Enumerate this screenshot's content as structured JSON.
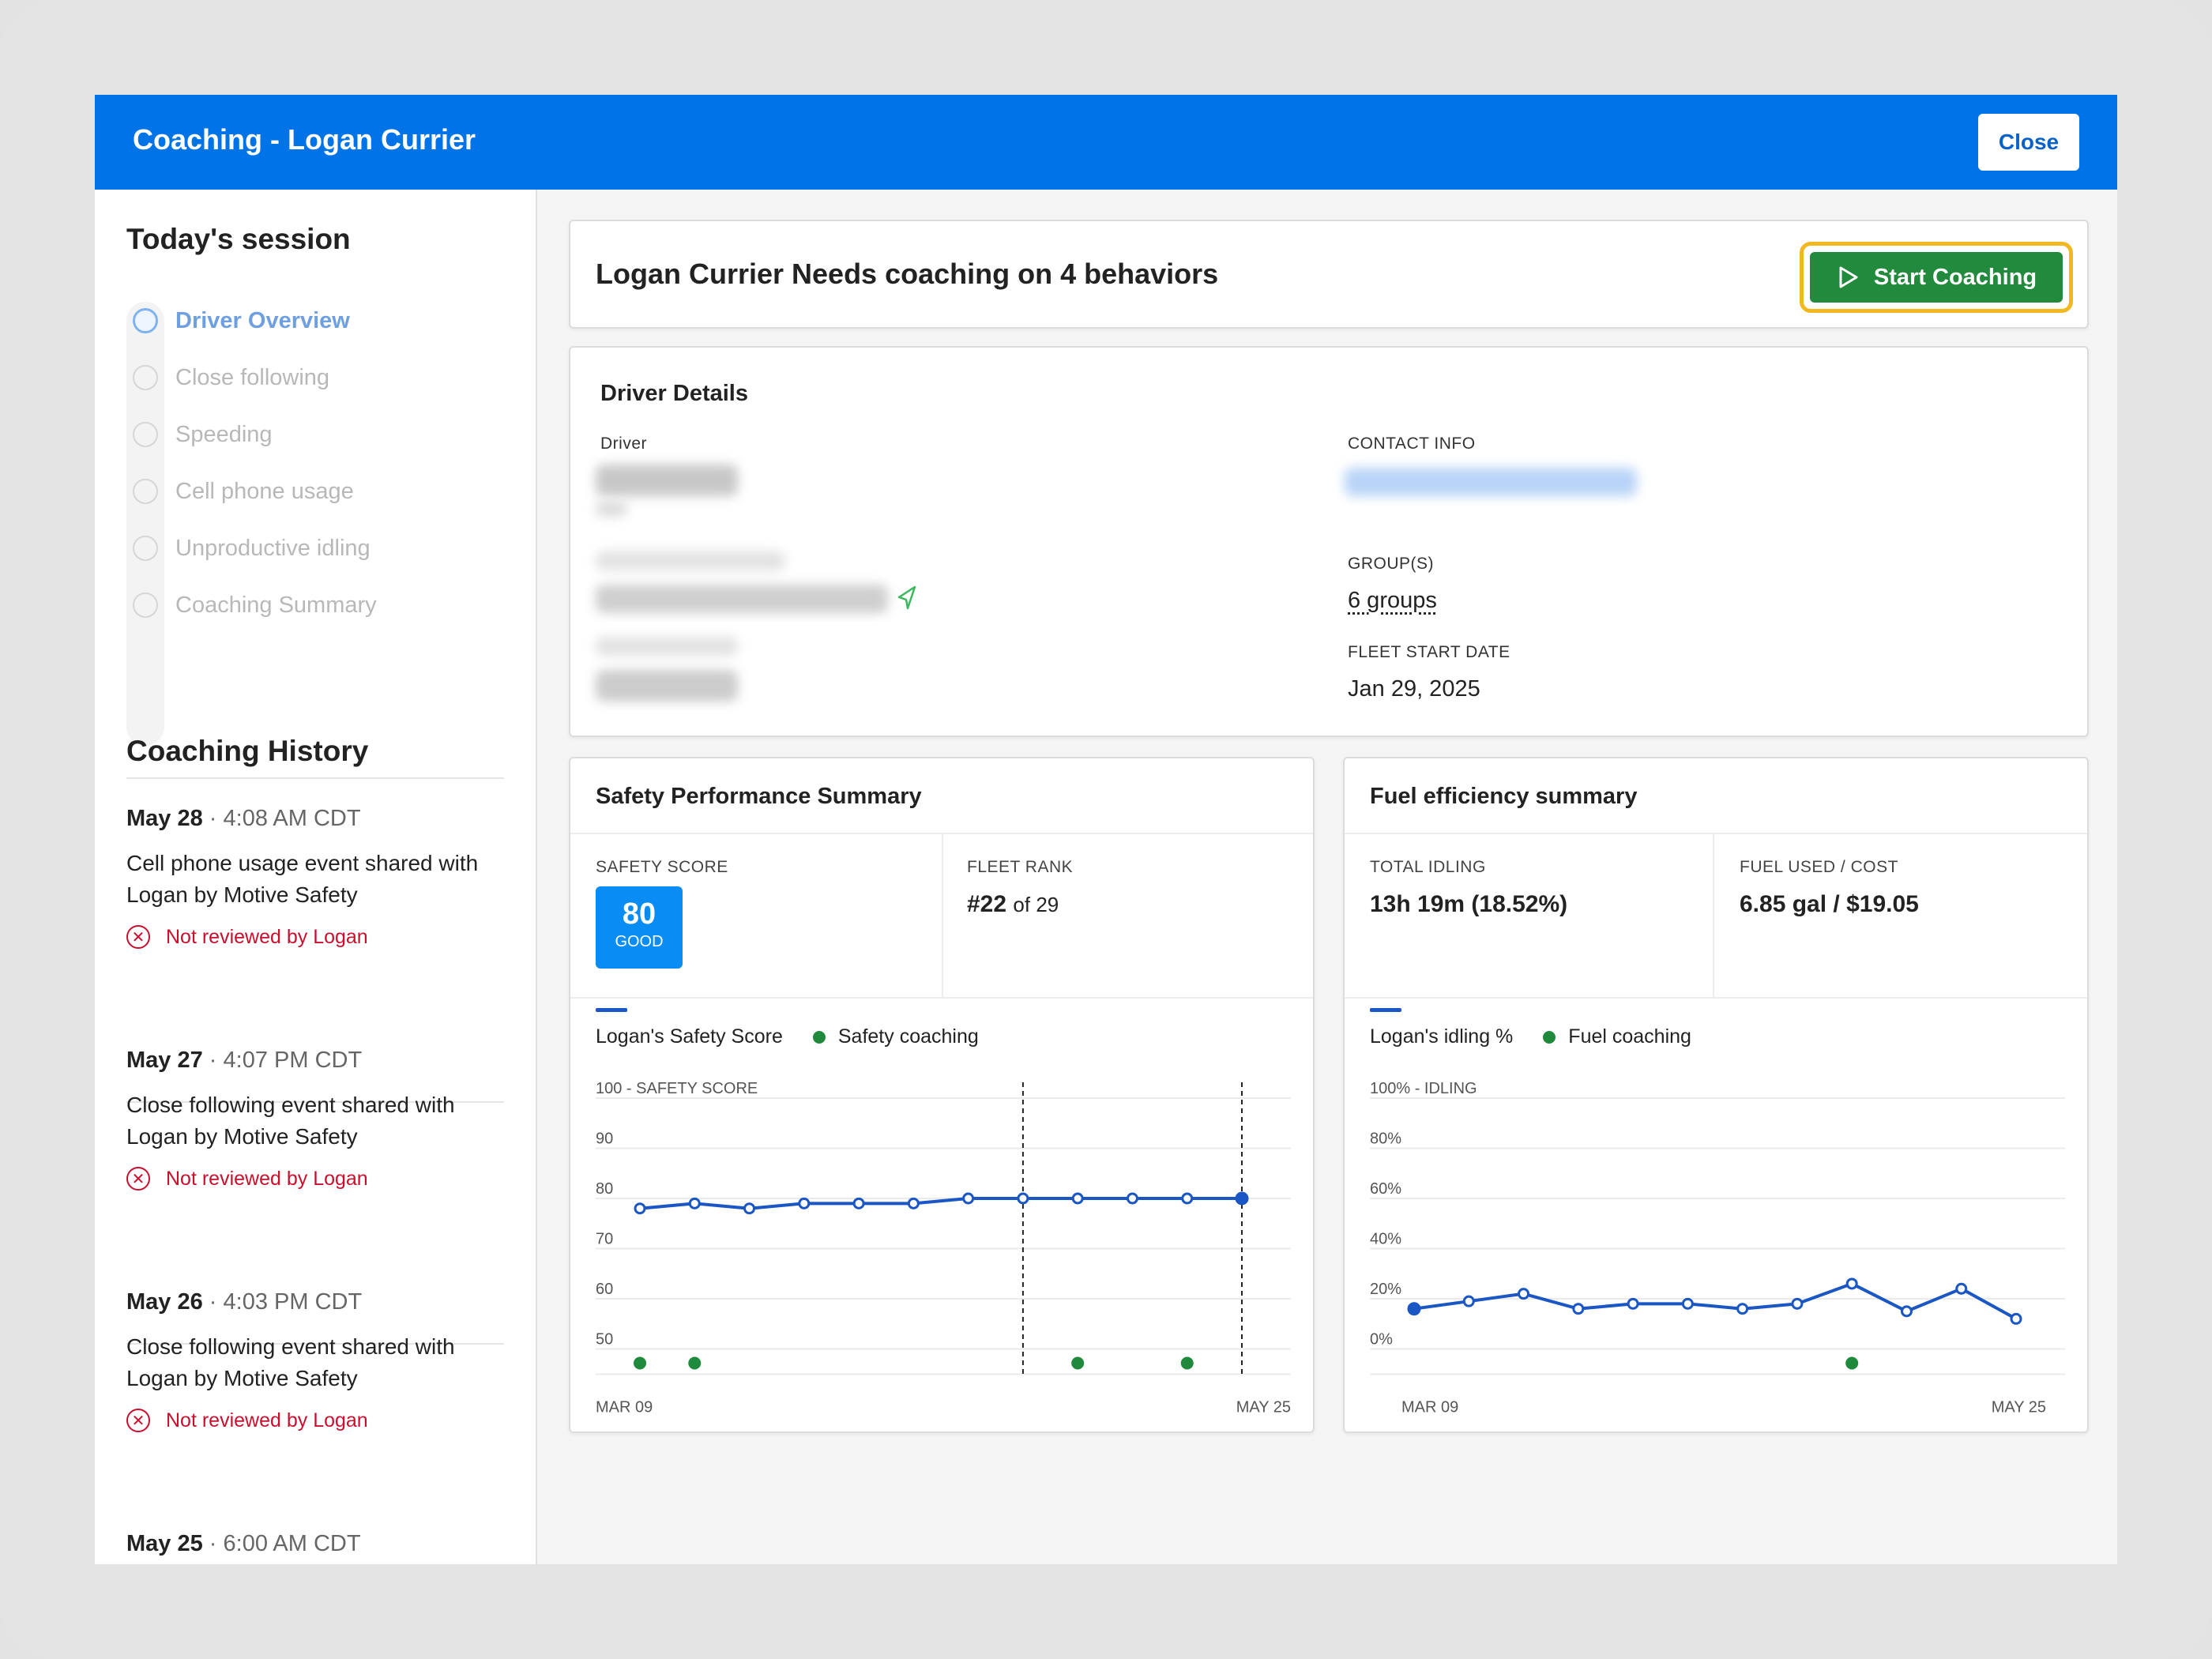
{
  "header": {
    "title": "Coaching - Logan Currier",
    "close_label": "Close"
  },
  "sidebar": {
    "session_title": "Today's session",
    "steps": [
      {
        "label": "Driver Overview",
        "active": true
      },
      {
        "label": "Close following",
        "active": false
      },
      {
        "label": "Speeding",
        "active": false
      },
      {
        "label": "Cell phone usage",
        "active": false
      },
      {
        "label": "Unproductive idling",
        "active": false
      },
      {
        "label": "Coaching Summary",
        "active": false
      }
    ],
    "history_title": "Coaching History",
    "history": [
      {
        "date": "May 28",
        "time": "4:08 AM CDT",
        "message": "Cell phone usage event shared with Logan by Motive Safety",
        "status": "Not reviewed by Logan"
      },
      {
        "date": "May 27",
        "time": "4:07 PM CDT",
        "message": "Close following event shared with Logan by Motive Safety",
        "status": "Not reviewed by Logan"
      },
      {
        "date": "May 26",
        "time": "4:03 PM CDT",
        "message": "Close following event shared with Logan by Motive Safety",
        "status": "Not reviewed by Logan"
      },
      {
        "date": "May 25",
        "time": "6:00 AM CDT",
        "message": "",
        "status": ""
      }
    ]
  },
  "main": {
    "headline": "Logan Currier Needs coaching on 4 behaviors",
    "start_button": "Start Coaching",
    "details": {
      "title": "Driver Details",
      "driver_label": "Driver",
      "contact_label": "CONTACT INFO",
      "groups_label": "GROUP(S)",
      "groups_value": "6 groups",
      "start_date_label": "FLEET START DATE",
      "start_date_value": "Jan 29, 2025"
    },
    "safety": {
      "title": "Safety Performance Summary",
      "score_label": "SAFETY SCORE",
      "score": "80",
      "score_grade": "GOOD",
      "rank_label": "FLEET RANK",
      "rank": "#22",
      "rank_of": "of 29",
      "legend_line": "Logan's Safety Score",
      "legend_dot": "Safety coaching"
    },
    "fuel": {
      "title": "Fuel efficiency summary",
      "idling_label": "TOTAL IDLING",
      "idling_value": "13h 19m (18.52%)",
      "fuel_label": "FUEL USED / COST",
      "fuel_value": "6.85 gal / $19.05",
      "legend_line": "Logan's idling %",
      "legend_dot": "Fuel coaching"
    }
  },
  "colors": {
    "brand": "#0073e6",
    "start_button": "#218a3c",
    "highlight": "#f2b81f",
    "line": "#1a56c4",
    "coaching_dot": "#1f8a3b",
    "warning": "#c8102e"
  },
  "chart_data": [
    {
      "type": "line",
      "name": "safety",
      "y_axis_title": "SAFETY SCORE",
      "yticks": [
        "100",
        "90",
        "80",
        "70",
        "60",
        "50"
      ],
      "ylim": [
        45,
        100
      ],
      "x_start_label": "MAR 09",
      "x_end_label": "MAY 25",
      "values": [
        78,
        79,
        78,
        79,
        79,
        79,
        80,
        80,
        80,
        80,
        80,
        80
      ],
      "coaching_points": [
        0,
        1,
        8,
        10
      ],
      "vlines": [
        7,
        11
      ],
      "filled_last": true
    },
    {
      "type": "line",
      "name": "fuel",
      "y_axis_title": "IDLING",
      "yticks": [
        "100%",
        "80%",
        "60%",
        "40%",
        "20%",
        "0%"
      ],
      "ylim": [
        -10,
        100
      ],
      "x_start_label": "MAR 09",
      "x_end_label": "MAY 25",
      "values": [
        16,
        19,
        22,
        16,
        18,
        18,
        16,
        18,
        26,
        15,
        24,
        12
      ],
      "coaching_points": [
        8
      ],
      "vlines": [],
      "filled_first": true
    }
  ]
}
